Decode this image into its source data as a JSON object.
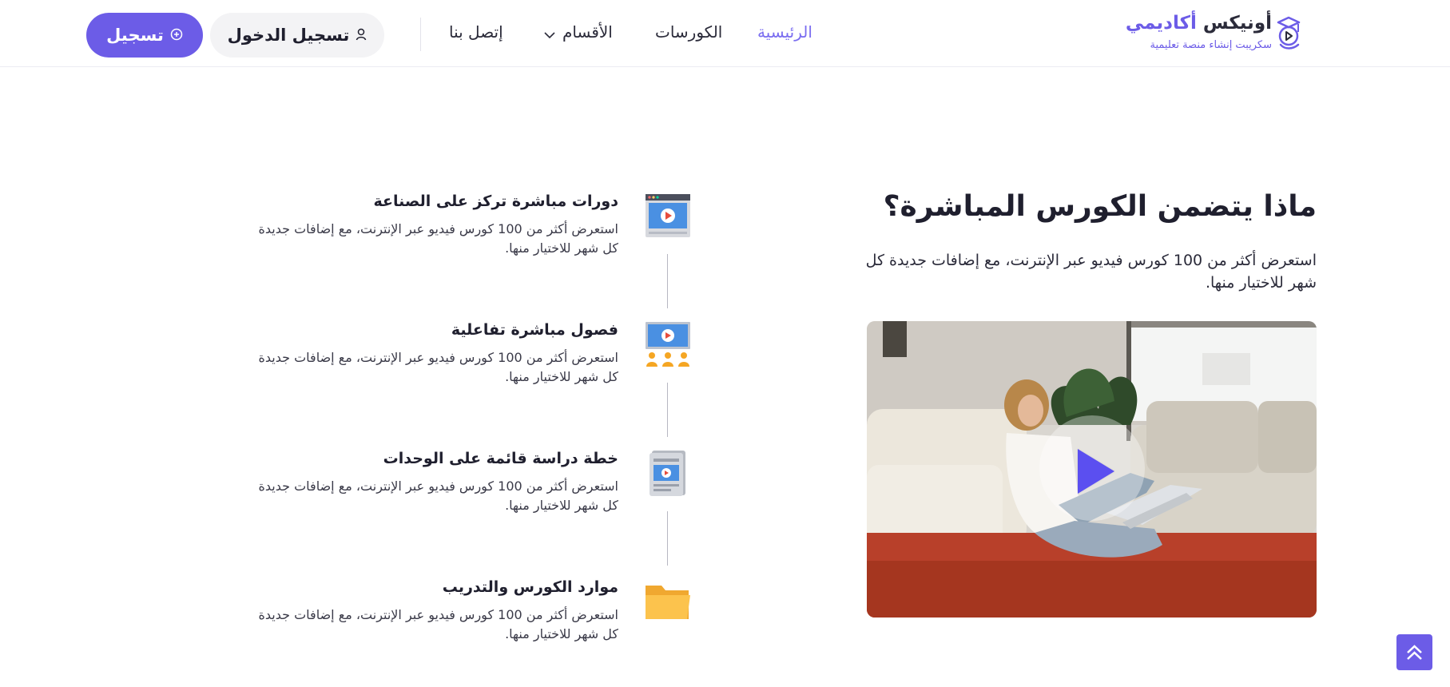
{
  "brand": {
    "title_main": "أونيكس",
    "title_accent": "أكاديمي",
    "subtitle": "سكريبت إنشاء منصة تعليمية",
    "accent_color": "#6c5ce7"
  },
  "nav": {
    "items": [
      {
        "label": "الرئيسية",
        "active": true
      },
      {
        "label": "الكورسات",
        "active": false
      },
      {
        "label": "الأقسام",
        "active": false,
        "icon": "chevron-down-icon"
      },
      {
        "label": "إتصل بنا",
        "active": false
      }
    ],
    "login_label": "تسجيل الدخول",
    "register_label": "تسجيل"
  },
  "section": {
    "heading": "ماذا يتضمن الكورس المباشرة؟",
    "description": "استعرض أكثر من 100 كورس فيديو عبر الإنترنت، مع إضافات جديدة كل شهر للاختيار منها.",
    "video_icon": "play-icon"
  },
  "features": [
    {
      "title": "دورات مباشرة تركز على الصناعة",
      "description": "استعرض أكثر من 100 كورس فيديو عبر الإنترنت، مع إضافات جديدة كل شهر للاختيار منها.",
      "icon": "video-window-icon"
    },
    {
      "title": "فصول مباشرة تفاعلية",
      "description": "استعرض أكثر من 100 كورس فيديو عبر الإنترنت، مع إضافات جديدة كل شهر للاختيار منها.",
      "icon": "video-audience-icon"
    },
    {
      "title": "خطة دراسة قائمة على الوحدات",
      "description": "استعرض أكثر من 100 كورس فيديو عبر الإنترنت، مع إضافات جديدة كل شهر للاختيار منها.",
      "icon": "video-document-icon"
    },
    {
      "title": "موارد الكورس والتدريب",
      "description": "استعرض أكثر من 100 كورس فيديو عبر الإنترنت، مع إضافات جديدة كل شهر للاختيار منها.",
      "icon": "folder-icon"
    }
  ],
  "scroll_top_icon": "double-chevron-up-icon"
}
